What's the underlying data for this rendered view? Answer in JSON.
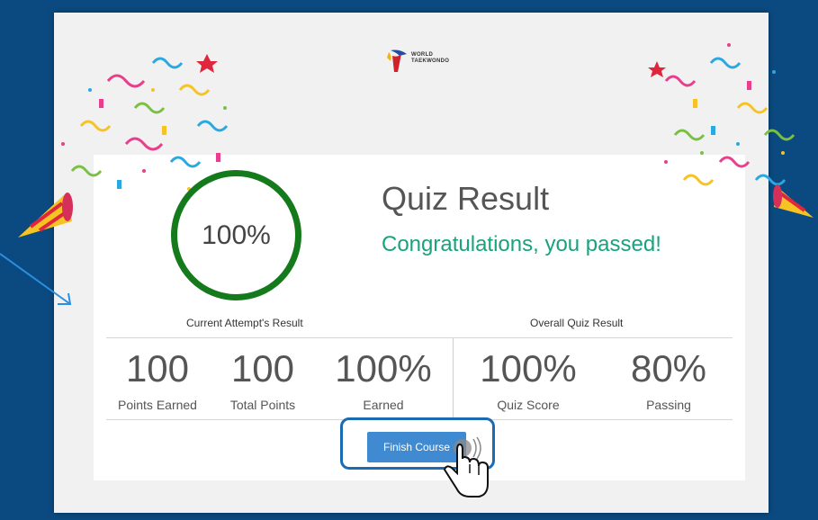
{
  "logo": {
    "text": "WORLD\nTAEKWONDO"
  },
  "result": {
    "score_display": "100%",
    "title": "Quiz Result",
    "message": "Congratulations, you passed!"
  },
  "sections": {
    "current": "Current Attempt's Result",
    "overall": "Overall Quiz Result"
  },
  "stats": [
    {
      "value": "100",
      "label": "Points Earned"
    },
    {
      "value": "100",
      "label": "Total Points"
    },
    {
      "value": "100%",
      "label": "Earned"
    },
    {
      "value": "100%",
      "label": "Quiz Score"
    },
    {
      "value": "80%",
      "label": "Passing"
    }
  ],
  "actions": {
    "finish_label": "Finish Course"
  },
  "colors": {
    "background": "#0b4a80",
    "ring": "#147a1c",
    "success_text": "#19a27e",
    "button": "#3f8ad0",
    "highlight": "#1b6bb3"
  }
}
